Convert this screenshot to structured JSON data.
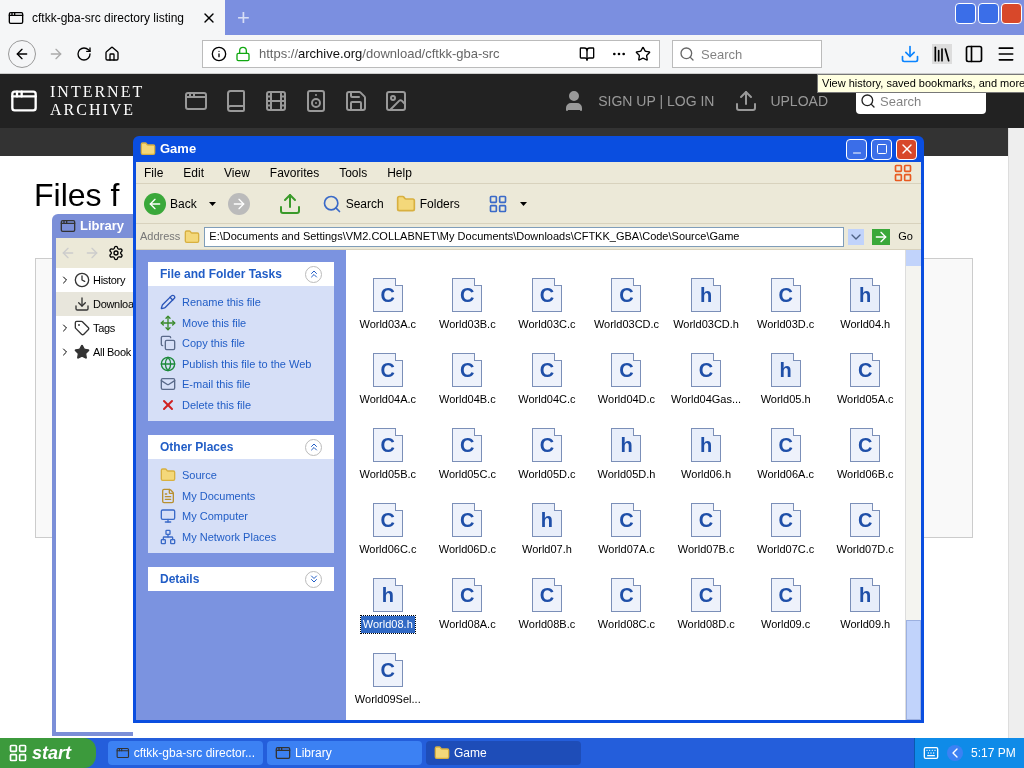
{
  "browser": {
    "tab": {
      "title": "cftkk-gba-src directory listing",
      "selected": true
    },
    "new_tab": "+",
    "url": {
      "scheme": "https://",
      "host": "archive.org",
      "path": "/download/cftkk-gba-src"
    },
    "search": {
      "placeholder": "Search"
    },
    "tooltip": "View history, saved bookmarks, and more"
  },
  "site_header": {
    "logo": [
      "INTERNET",
      "ARCHIVE"
    ],
    "account": "SIGN UP | LOG IN",
    "upload": "UPLOAD",
    "search": {
      "placeholder": "Search"
    }
  },
  "page": {
    "heading": "Files f"
  },
  "library": {
    "title": "Library",
    "items": [
      {
        "label": "History",
        "expandable": true,
        "selected": false
      },
      {
        "label": "Downloa",
        "expandable": false,
        "selected": true
      },
      {
        "label": "Tags",
        "expandable": true,
        "selected": false
      },
      {
        "label": "All Book",
        "expandable": true,
        "selected": false
      }
    ]
  },
  "explorer": {
    "title": "Game",
    "menu": [
      "File",
      "Edit",
      "View",
      "Favorites",
      "Tools",
      "Help"
    ],
    "toolbar": {
      "back": "Back",
      "search": "Search",
      "folders": "Folders"
    },
    "address": {
      "label": "Address",
      "path": "E:\\Documents and Settings\\VM2.COLLABNET\\My Documents\\Downloads\\CFTKK_GBA\\Code\\Source\\Game",
      "go": "Go"
    },
    "panels": [
      {
        "title": "File and Folder Tasks",
        "expanded": true,
        "items": [
          {
            "label": "Rename this file",
            "kind": "rename"
          },
          {
            "label": "Move this file",
            "kind": "move"
          },
          {
            "label": "Copy this file",
            "kind": "copy"
          },
          {
            "label": "Publish this file to the Web",
            "kind": "publish"
          },
          {
            "label": "E-mail this file",
            "kind": "email"
          },
          {
            "label": "Delete this file",
            "kind": "delete"
          }
        ]
      },
      {
        "title": "Other Places",
        "expanded": true,
        "items": [
          {
            "label": "Source",
            "kind": "folder"
          },
          {
            "label": "My Documents",
            "kind": "documents"
          },
          {
            "label": "My Computer",
            "kind": "computer"
          },
          {
            "label": "My Network Places",
            "kind": "network"
          }
        ]
      },
      {
        "title": "Details",
        "expanded": false
      }
    ],
    "files": [
      {
        "name": "World03A.c",
        "kind": "c",
        "glyph": "C",
        "selected": false
      },
      {
        "name": "World03B.c",
        "kind": "c",
        "glyph": "C",
        "selected": false
      },
      {
        "name": "World03C.c",
        "kind": "c",
        "glyph": "C",
        "selected": false
      },
      {
        "name": "World03CD.c",
        "kind": "c",
        "glyph": "C",
        "selected": false
      },
      {
        "name": "World03CD.h",
        "kind": "h",
        "glyph": "h",
        "selected": false
      },
      {
        "name": "World03D.c",
        "kind": "c",
        "glyph": "C",
        "selected": false
      },
      {
        "name": "World04.h",
        "kind": "h",
        "glyph": "h",
        "selected": false
      },
      {
        "name": "World04A.c",
        "kind": "c",
        "glyph": "C",
        "selected": false
      },
      {
        "name": "World04B.c",
        "kind": "c",
        "glyph": "C",
        "selected": false
      },
      {
        "name": "World04C.c",
        "kind": "c",
        "glyph": "C",
        "selected": false
      },
      {
        "name": "World04D.c",
        "kind": "c",
        "glyph": "C",
        "selected": false
      },
      {
        "name": "World04Gas...",
        "kind": "c",
        "glyph": "C",
        "selected": false
      },
      {
        "name": "World05.h",
        "kind": "h",
        "glyph": "h",
        "selected": false
      },
      {
        "name": "World05A.c",
        "kind": "c",
        "glyph": "C",
        "selected": false
      },
      {
        "name": "World05B.c",
        "kind": "c",
        "glyph": "C",
        "selected": false
      },
      {
        "name": "World05C.c",
        "kind": "c",
        "glyph": "C",
        "selected": false
      },
      {
        "name": "World05D.c",
        "kind": "c",
        "glyph": "C",
        "selected": false
      },
      {
        "name": "World05D.h",
        "kind": "h",
        "glyph": "h",
        "selected": false
      },
      {
        "name": "World06.h",
        "kind": "h",
        "glyph": "h",
        "selected": false
      },
      {
        "name": "World06A.c",
        "kind": "c",
        "glyph": "C",
        "selected": false
      },
      {
        "name": "World06B.c",
        "kind": "c",
        "glyph": "C",
        "selected": false
      },
      {
        "name": "World06C.c",
        "kind": "c",
        "glyph": "C",
        "selected": false
      },
      {
        "name": "World06D.c",
        "kind": "c",
        "glyph": "C",
        "selected": false
      },
      {
        "name": "World07.h",
        "kind": "h",
        "glyph": "h",
        "selected": false
      },
      {
        "name": "World07A.c",
        "kind": "c",
        "glyph": "C",
        "selected": false
      },
      {
        "name": "World07B.c",
        "kind": "c",
        "glyph": "C",
        "selected": false
      },
      {
        "name": "World07C.c",
        "kind": "c",
        "glyph": "C",
        "selected": false
      },
      {
        "name": "World07D.c",
        "kind": "c",
        "glyph": "C",
        "selected": false
      },
      {
        "name": "World08.h",
        "kind": "h",
        "glyph": "h",
        "selected": true
      },
      {
        "name": "World08A.c",
        "kind": "c",
        "glyph": "C",
        "selected": false
      },
      {
        "name": "World08B.c",
        "kind": "c",
        "glyph": "C",
        "selected": false
      },
      {
        "name": "World08C.c",
        "kind": "c",
        "glyph": "C",
        "selected": false
      },
      {
        "name": "World08D.c",
        "kind": "c",
        "glyph": "C",
        "selected": false
      },
      {
        "name": "World09.c",
        "kind": "c",
        "glyph": "C",
        "selected": false
      },
      {
        "name": "World09.h",
        "kind": "h",
        "glyph": "h",
        "selected": false
      },
      {
        "name": "World09Sel...",
        "kind": "c",
        "glyph": "C",
        "selected": false
      }
    ]
  },
  "taskbar": {
    "start": "start",
    "tasks": [
      {
        "label": "cftkk-gba-src director...",
        "kind": "app",
        "selected": false
      },
      {
        "label": "Library",
        "kind": "app",
        "selected": false
      },
      {
        "label": "Game",
        "kind": "folder",
        "selected": true
      }
    ],
    "clock": "5:17 PM"
  }
}
